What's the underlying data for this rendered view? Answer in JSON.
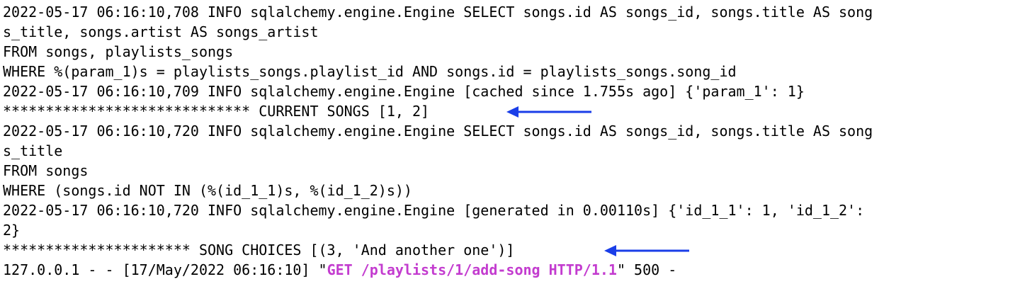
{
  "terminal": {
    "lines": [
      "2022-05-17 06:16:10,708 INFO sqlalchemy.engine.Engine SELECT songs.id AS songs_id, songs.title AS song",
      "s_title, songs.artist AS songs_artist",
      "FROM songs, playlists_songs",
      "WHERE %(param_1)s = playlists_songs.playlist_id AND songs.id = playlists_songs.song_id",
      "2022-05-17 06:16:10,709 INFO sqlalchemy.engine.Engine [cached since 1.755s ago] {'param_1': 1}",
      "***************************** CURRENT SONGS [1, 2]",
      "2022-05-17 06:16:10,720 INFO sqlalchemy.engine.Engine SELECT songs.id AS songs_id, songs.title AS song",
      "s_title",
      "FROM songs",
      "WHERE (songs.id NOT IN (%(id_1_1)s, %(id_1_2)s))",
      "2022-05-17 06:16:10,720 INFO sqlalchemy.engine.Engine [generated in 0.00110s] {'id_1_1': 1, 'id_1_2':",
      "2}",
      "********************** SONG CHOICES [(3, 'And another one')]"
    ],
    "request_line": {
      "prefix": "127.0.0.1 - - [17/May/2022 06:16:10] \"",
      "highlight": "GET /playlists/1/add-song HTTP/1.1",
      "suffix": "\" 500 -"
    },
    "highlight_color": "#c33ccf",
    "arrow_color": "#1a3ee8"
  }
}
